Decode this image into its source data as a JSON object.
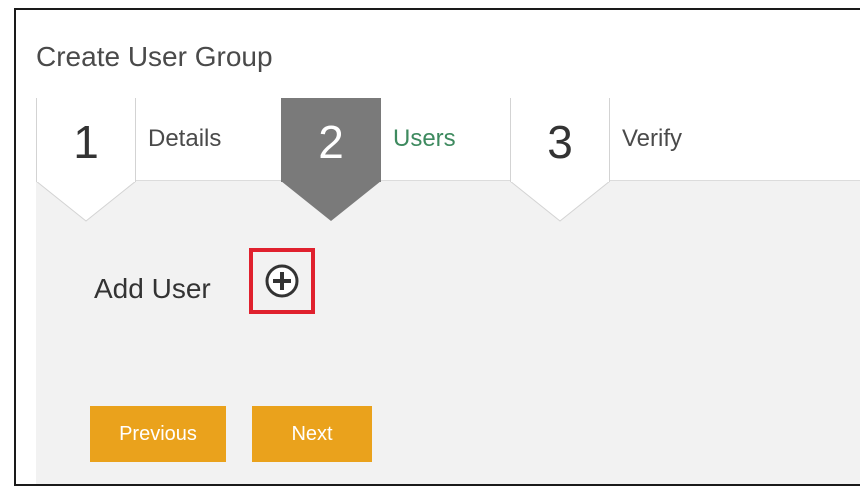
{
  "page": {
    "title": "Create User Group"
  },
  "wizard": {
    "steps": [
      {
        "number": "1",
        "label": "Details",
        "state": "completed"
      },
      {
        "number": "2",
        "label": "Users",
        "state": "active"
      },
      {
        "number": "3",
        "label": "Verify",
        "state": "pending"
      }
    ]
  },
  "users_step": {
    "add_user_label": "Add User",
    "add_icon": "plus-circle-icon",
    "highlight_color": "#e0212e"
  },
  "actions": {
    "previous_label": "Previous",
    "next_label": "Next"
  },
  "colors": {
    "button": "#eaa21c",
    "active_step": "#7a7a7a",
    "active_label": "#3e8a5f",
    "content_background": "#f2f2f2"
  }
}
